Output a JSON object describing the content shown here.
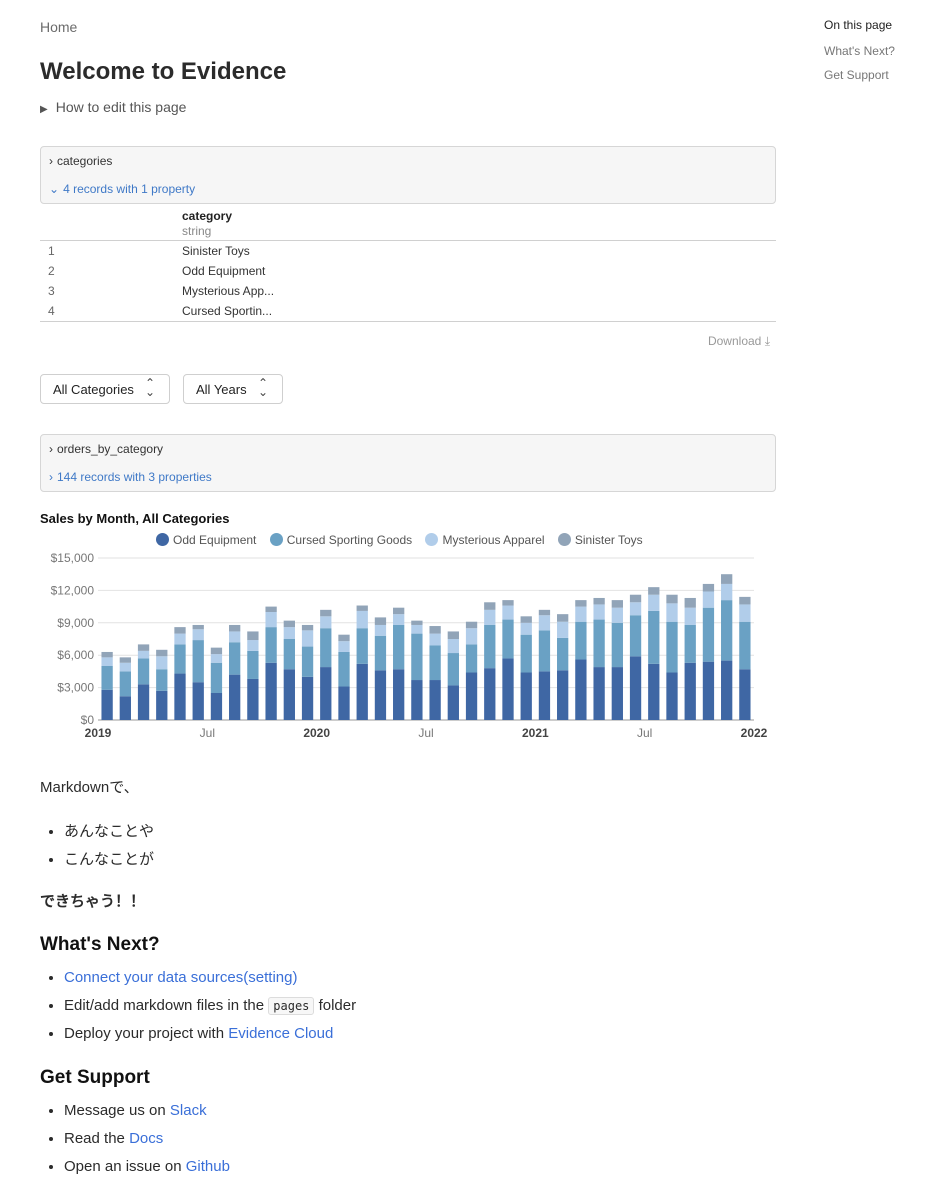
{
  "breadcrumb": "Home",
  "title": "Welcome to Evidence",
  "details_label": "How to edit this page",
  "categories_query": {
    "name": "categories",
    "records": "4 records with 1 property",
    "column": {
      "name": "category",
      "type": "string"
    },
    "rows": [
      {
        "idx": "1",
        "value": "Sinister Toys"
      },
      {
        "idx": "2",
        "value": "Odd Equipment"
      },
      {
        "idx": "3",
        "value": "Mysterious App..."
      },
      {
        "idx": "4",
        "value": "Cursed Sportin..."
      }
    ],
    "download": "Download"
  },
  "filters": {
    "category": "All Categories",
    "year": "All Years"
  },
  "orders_query": {
    "name": "orders_by_category",
    "records": "144 records with 3 properties"
  },
  "chart_data": {
    "type": "bar",
    "stacked": true,
    "title": "Sales by Month, All Categories",
    "xlabel": "",
    "ylabel": "",
    "legend_position": "top",
    "ylim": [
      0,
      15000
    ],
    "y_ticks": [
      "$0",
      "$3,000",
      "$6,000",
      "$9,000",
      "$12,000",
      "$15,000"
    ],
    "x_ticks": [
      {
        "label": "2019",
        "index": 0
      },
      {
        "label": "Jul",
        "index": 6
      },
      {
        "label": "2020",
        "index": 12
      },
      {
        "label": "Jul",
        "index": 18
      },
      {
        "label": "2021",
        "index": 24
      },
      {
        "label": "Jul",
        "index": 30
      },
      {
        "label": "2022",
        "index": 36
      }
    ],
    "categories": [
      "2019-01",
      "2019-02",
      "2019-03",
      "2019-04",
      "2019-05",
      "2019-06",
      "2019-07",
      "2019-08",
      "2019-09",
      "2019-10",
      "2019-11",
      "2019-12",
      "2020-01",
      "2020-02",
      "2020-03",
      "2020-04",
      "2020-05",
      "2020-06",
      "2020-07",
      "2020-08",
      "2020-09",
      "2020-10",
      "2020-11",
      "2020-12",
      "2021-01",
      "2021-02",
      "2021-03",
      "2021-04",
      "2021-05",
      "2021-06",
      "2021-07",
      "2021-08",
      "2021-09",
      "2021-10",
      "2021-11",
      "2021-12"
    ],
    "series": [
      {
        "name": "Odd Equipment",
        "color": "#3f67a4",
        "values": [
          2800,
          2200,
          3300,
          2700,
          4300,
          3500,
          2500,
          4200,
          3800,
          5300,
          4700,
          4000,
          4900,
          3100,
          5200,
          4600,
          4700,
          3700,
          3700,
          3200,
          4400,
          4800,
          5700,
          4400,
          4500,
          4600,
          5600,
          4900,
          4900,
          5900,
          5200,
          4400,
          5300,
          5400,
          5500,
          4700
        ]
      },
      {
        "name": "Cursed Sporting Goods",
        "color": "#6aa1c4",
        "values": [
          2200,
          2300,
          2400,
          2000,
          2700,
          3900,
          2800,
          3000,
          2600,
          3300,
          2800,
          2800,
          3600,
          3200,
          3300,
          3200,
          4100,
          4300,
          3200,
          3000,
          2600,
          4000,
          3600,
          3500,
          3800,
          3000,
          3500,
          4400,
          4100,
          3800,
          4900,
          4700,
          3500,
          5000,
          5600,
          4400
        ]
      },
      {
        "name": "Mysterious Apparel",
        "color": "#b1cdea",
        "values": [
          800,
          800,
          700,
          1200,
          1000,
          1000,
          800,
          1000,
          1000,
          1400,
          1100,
          1500,
          1100,
          1000,
          1600,
          1000,
          1000,
          800,
          1100,
          1300,
          1500,
          1400,
          1300,
          1100,
          1400,
          1500,
          1400,
          1400,
          1400,
          1200,
          1500,
          1700,
          1600,
          1500,
          1500,
          1600
        ]
      },
      {
        "name": "Sinister Toys",
        "color": "#91a4b8",
        "values": [
          500,
          500,
          600,
          600,
          600,
          400,
          600,
          600,
          800,
          500,
          600,
          500,
          600,
          600,
          500,
          700,
          600,
          400,
          700,
          700,
          600,
          700,
          500,
          600,
          500,
          700,
          600,
          600,
          700,
          700,
          700,
          800,
          900,
          700,
          900,
          700
        ]
      }
    ]
  },
  "markdown_intro": "Markdownで、",
  "markdown_list": [
    "あんなことや",
    "こんなことが"
  ],
  "markdown_bold": "できちゃう！！",
  "whats_next": {
    "heading": "What's Next?",
    "connect_link": "Connect your data sources(setting)",
    "edit_prefix": "Edit/add markdown files in the",
    "edit_code": "pages",
    "edit_suffix": "folder",
    "deploy_prefix": "Deploy your project with",
    "deploy_link": "Evidence Cloud"
  },
  "get_support": {
    "heading": "Get Support",
    "slack_prefix": "Message us on",
    "slack_link": "Slack",
    "docs_prefix": "Read the",
    "docs_link": "Docs",
    "github_prefix": "Open an issue on",
    "github_link": "Github"
  },
  "toc": {
    "title": "On this page",
    "items": [
      "What's Next?",
      "Get Support"
    ]
  }
}
